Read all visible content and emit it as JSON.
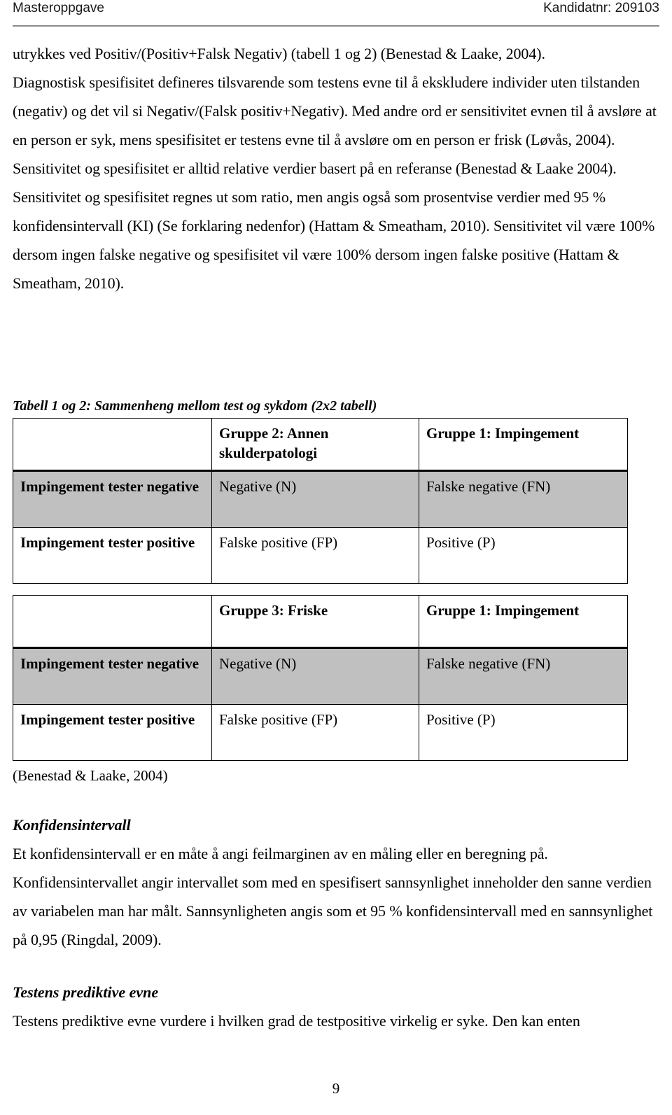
{
  "header": {
    "left": "Masteroppgave",
    "right": "Kandidatnr: 209103"
  },
  "body": {
    "para1": "utrykkes ved Positiv/(Positiv+Falsk Negativ) (tabell 1 og 2) (Benestad & Laake, 2004).",
    "para2": "Diagnostisk spesifisitet defineres tilsvarende som testens evne til å ekskludere individer uten tilstanden (negativ) og det vil si Negativ/(Falsk positiv+Negativ). Med andre ord er sensitivitet evnen til å avsløre at en person er syk, mens spesifisitet er testens evne til å avsløre om en person er frisk (Løvås, 2004). Sensitivitet og spesifisitet er alltid relative verdier basert på en referanse (Benestad & Laake 2004). Sensitivitet og spesifisitet regnes ut som ratio, men angis også som prosentvise verdier med 95 % konfidensintervall (KI) (Se forklaring nedenfor) (Hattam & Smeatham, 2010). Sensitivitet vil være 100% dersom ingen falske negative og spesifisitet vil være 100% dersom ingen falske positive (Hattam & Smeatham, 2010)."
  },
  "tables": {
    "caption": "Tabell 1 og 2: Sammenheng mellom test og sykdom (2x2 tabell)",
    "note": "(Benestad & Laake, 2004)",
    "table1": {
      "corner": "",
      "col2_header": "Gruppe 2: Annen skulderpatologi",
      "col3_header": "Gruppe 1: Impingement",
      "rows": [
        {
          "label": "Impingement tester negative",
          "cell2": "Negative (N)",
          "cell3": "Falske negative (FN)"
        },
        {
          "label": "Impingement tester positive",
          "cell2": "Falske positive (FP)",
          "cell3": "Positive (P)"
        }
      ]
    },
    "table2": {
      "corner": "",
      "col2_header": "Gruppe 3: Friske",
      "col3_header": "Gruppe 1: Impingement",
      "rows": [
        {
          "label": "Impingement tester negative",
          "cell2": "Negative (N)",
          "cell3": "Falske negative (FN)"
        },
        {
          "label": "Impingement tester positive",
          "cell2": "Falske positive (FP)",
          "cell3": "Positive (P)"
        }
      ]
    }
  },
  "sections": {
    "konfidensintervall": {
      "heading": "Konfidensintervall",
      "para": "Et konfidensintervall er en måte å angi feilmarginen av en måling eller en beregning på. Konfidensintervallet angir intervallet som med en spesifisert sannsynlighet inneholder den sanne verdien av variabelen man har målt. Sannsynligheten angis som et 95 % konfidensintervall med en sannsynlighet på 0,95 (Ringdal, 2009)."
    },
    "prediktive": {
      "heading": "Testens prediktive evne",
      "para": "Testens prediktive evne vurdere i hvilken grad de testpositive virkelig er syke. Den kan enten"
    }
  },
  "footer": {
    "page_number": "9"
  }
}
